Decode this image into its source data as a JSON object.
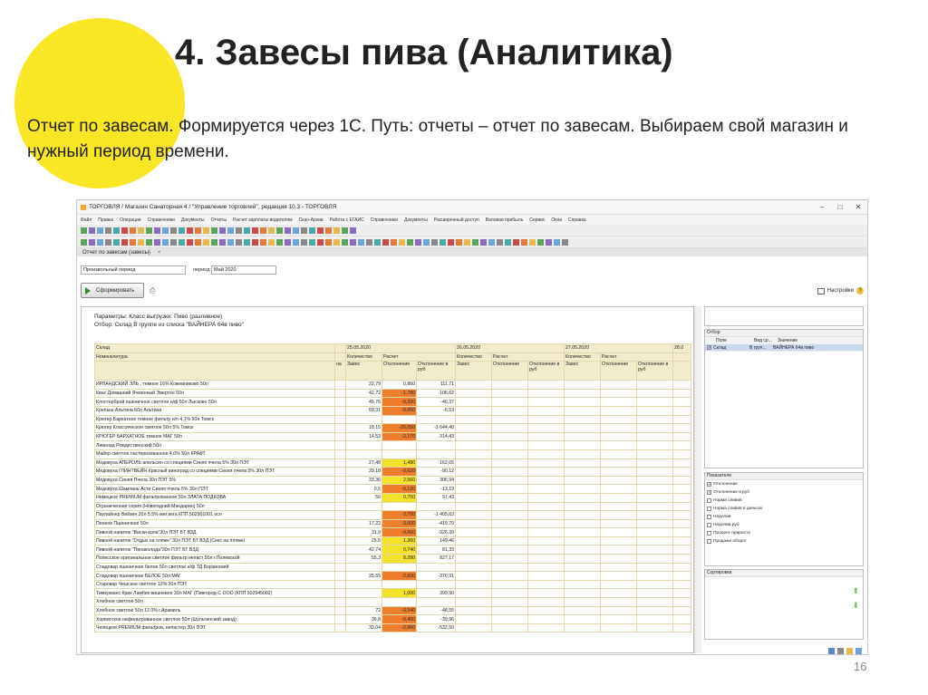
{
  "slide": {
    "title": "4. Завесы пива (Аналитика)",
    "description": "Отчет по завесам. Формируется через 1С. Путь: отчеты – отчет по завесам. Выбираем свой магазин и нужный период времени.",
    "page_number": "16",
    "accent_color": "#fbe625"
  },
  "window": {
    "title": "ТОРГОВЛЯ / Магазин Санаторная 4 / \"Управление торговлей\", редакция 10.3 - ТОРГОВЛЯ",
    "minimize": "–",
    "maximize": "□",
    "close": "✕",
    "menu": [
      "Файл",
      "Правка",
      "Операции",
      "Справочники",
      "Документы",
      "Отчеты",
      "Расчет зарплаты водителям",
      "Скан-Архив",
      "Работа с ЕГАИС",
      "Справочники",
      "Документы",
      "Расширенный доступ",
      "Валовая прибыль",
      "Сервис",
      "Окна",
      "Справка"
    ]
  },
  "form": {
    "tab_label": "Отчет по завесам (завесы)",
    "period_type": "Произвольный период",
    "period_label": "период:",
    "period_value": "Май 2020",
    "generate_label": "Сформировать",
    "settings_label": "Настройки",
    "params_line1": "Параметры: Класс выгрузки: Пиво (разливное)",
    "params_line2": "Отбор:       Склад В группе из списка \"ВАЙНЕРА 64в пиво\""
  },
  "report": {
    "col_sklad": "Склад",
    "col_nomen": "Номенклатура",
    "dates": [
      "25.05.2020",
      "26.05.2020",
      "27.05.2020",
      "28.0"
    ],
    "sub_kolvo": "Количество",
    "sub_raschet": "Расчет",
    "sub_zaves": "Завес",
    "sub_otkl": "Отклонение",
    "sub_otkl_rub": "Отклонение в руб",
    "sub_na": "на",
    "rows": [
      {
        "name": "ИРЛАНДСКИЙ ЭЛЬ , темное 16% Кожевниково 50л",
        "zaves": "22,79",
        "otkl": "0,860",
        "rub": "111,71",
        "c": ""
      },
      {
        "name": "Квас Домашний Ячменный Эвертон 50л",
        "zaves": "42,72",
        "otkl": "-1,780",
        "rub": "-106,62",
        "c": "or"
      },
      {
        "name": "Клостерброй пшеничное светлое н/ф 50л Лысково 50л",
        "zaves": "45,76",
        "otkl": "-0,320",
        "rub": "-46,37",
        "c": "or"
      },
      {
        "name": "Крепыш Альтина 50л Альтина",
        "zaves": "59,31",
        "otkl": "-0,060",
        "rub": "-6,53",
        "c": "or"
      },
      {
        "name": "Крюгер Бархатное темное фильтр н/п 4,1% 50л Томск",
        "zaves": "",
        "otkl": "",
        "rub": "",
        "c": ""
      },
      {
        "name": "Крюгер Классическое светлое 50л 5% Томск",
        "zaves": "18,15",
        "otkl": "-26,050",
        "rub": "-3 644,40",
        "c": "or"
      },
      {
        "name": "КРЮГЕР БАРХАТНОЕ темное МАГ 50л",
        "zaves": "14,53",
        "otkl": "-2,170",
        "rub": "-314,43",
        "c": "or"
      },
      {
        "name": "Ливенад Рождественский 50л",
        "zaves": "",
        "otkl": "",
        "rub": "",
        "c": ""
      },
      {
        "name": "Майер светлое пастеризованное 4,0% 50л КРАФТ",
        "zaves": "",
        "otkl": "",
        "rub": "",
        "c": ""
      },
      {
        "name": "Медовуха АПЕРОЛЬ апельсин со специями Синяя пчела 5% 30л ПЭТ",
        "zaves": "27,48",
        "otkl": "1,480",
        "rub": "162,65",
        "c": "ye"
      },
      {
        "name": "Медовуха ГЛИНТВЕЙН Красный виноград со специями Синяя пчела 5% 30л ПЭТ",
        "zaves": "29,18",
        "otkl": "-0,620",
        "rub": "-90,12",
        "c": "or"
      },
      {
        "name": "Медовуха Синяя Пчела 30л ПЭТ 5%",
        "zaves": "33,36",
        "otkl": "2,560",
        "rub": "306,94",
        "c": "ye"
      },
      {
        "name": "Медовуха Шампань Асти Синяя пчела 5% 30л ПЭТ",
        "zaves": "0,5",
        "otkl": "-0,120",
        "rub": "-13,19",
        "c": "or"
      },
      {
        "name": "Немецкое PREMIUM фильтрованное 50л ЗЛАТА ПОДКОВА",
        "zaves": "50",
        "otkl": "0,750",
        "rub": "97,43",
        "c": "ye"
      },
      {
        "name": "Ограниченная серия (Новогодний Мандарин) 50л",
        "zaves": "",
        "otkl": "",
        "rub": "",
        "c": ""
      },
      {
        "name": "Паулайнер Вейзен 20л 5,5% мет.кега КПП 502901001 осн",
        "zaves": "",
        "otkl": "-3,700",
        "rub": "-1 405,63",
        "c": "or"
      },
      {
        "name": "Пенное Пшеничное 50л",
        "zaves": "17,22",
        "otkl": "-3,000",
        "rub": "-419,70",
        "c": "or"
      },
      {
        "name": "Пивной напиток \"Виски-кола\"30л ПЭТ БТ ВЗД",
        "zaves": "31,9",
        "otkl": "-9,660",
        "rub": "-926,39",
        "c": "or"
      },
      {
        "name": "Пивной напиток \"Отдых на пляже\" 30л ПЭТ БТ ВЗД (Секс на пляже)",
        "zaves": "25,6",
        "otkl": "1,360",
        "rub": "149,46",
        "c": "ye"
      },
      {
        "name": "Пивной напиток \"Пинаколада\"30л ПЭТ БТ ВЗД",
        "zaves": "42,74",
        "otkl": "0,740",
        "rub": "81,33",
        "c": "ye"
      },
      {
        "name": "Полесское оригинальное светлое фильтр непаст 50л г.Полевской",
        "zaves": "55,3",
        "otkl": "8,280",
        "rub": "827,17",
        "c": "ye"
      },
      {
        "name": "Сладовар пшеничное белое 50л светлое н/ф ТД Борзинский",
        "zaves": "",
        "otkl": "",
        "rub": "",
        "c": ""
      },
      {
        "name": "Сладовар пшеничное БЕЛОЕ 50л МАГ",
        "zaves": "25,55",
        "otkl": "-2,600",
        "rub": "-370,91",
        "c": "or"
      },
      {
        "name": "Старовар Чешское светлое 12% 30л ПЭТ",
        "zaves": "",
        "otkl": "",
        "rub": "",
        "c": ""
      },
      {
        "name": "Тимерманс Крик Ламбик вишневое 30л МАГ (Пивгород-С ООО (КПП 502945002)",
        "zaves": "",
        "otkl": "1,000",
        "rub": "399,90",
        "c": "ye"
      },
      {
        "name": "Хлебное светлое 50л",
        "zaves": "",
        "otkl": "",
        "rub": "",
        "c": ""
      },
      {
        "name": "Хлебное светлое 50л 12.0% г.Арамиль",
        "zaves": "72",
        "otkl": "-0,540",
        "rub": "-48,55",
        "c": "or"
      },
      {
        "name": "Хорватское нефильтрованное светлое 50л (Шульгинский завод)",
        "zaves": "36,8",
        "otkl": "-0,400",
        "rub": "-39,96",
        "c": "or"
      },
      {
        "name": "Чепецкое PREMIUM фильтров, непастер 30л ПЭТ",
        "zaves": "33,04",
        "otkl": "-2,960",
        "rub": "-532,50",
        "c": "or"
      }
    ]
  },
  "side": {
    "filter_title": "Отбор",
    "filter_cols": [
      "Поле",
      "Вид ср...",
      "Значение"
    ],
    "filter_row": [
      "Склад",
      "В груп...",
      "ВАЙНЕРА 64в пиво"
    ],
    "indicators_title": "Показатели",
    "indicators": [
      {
        "label": "Отклонение",
        "on": true
      },
      {
        "label": "Отклонение в руб",
        "on": true
      },
      {
        "label": "Норма сливов",
        "on": false
      },
      {
        "label": "Норма сливов в деньгах",
        "on": false
      },
      {
        "label": "Недолив",
        "on": false
      },
      {
        "label": "Недолив руб",
        "on": false
      },
      {
        "label": "Процент прироста",
        "on": false
      },
      {
        "label": "Продажи оборот",
        "on": false
      }
    ],
    "sort_title": "Сортировка"
  }
}
